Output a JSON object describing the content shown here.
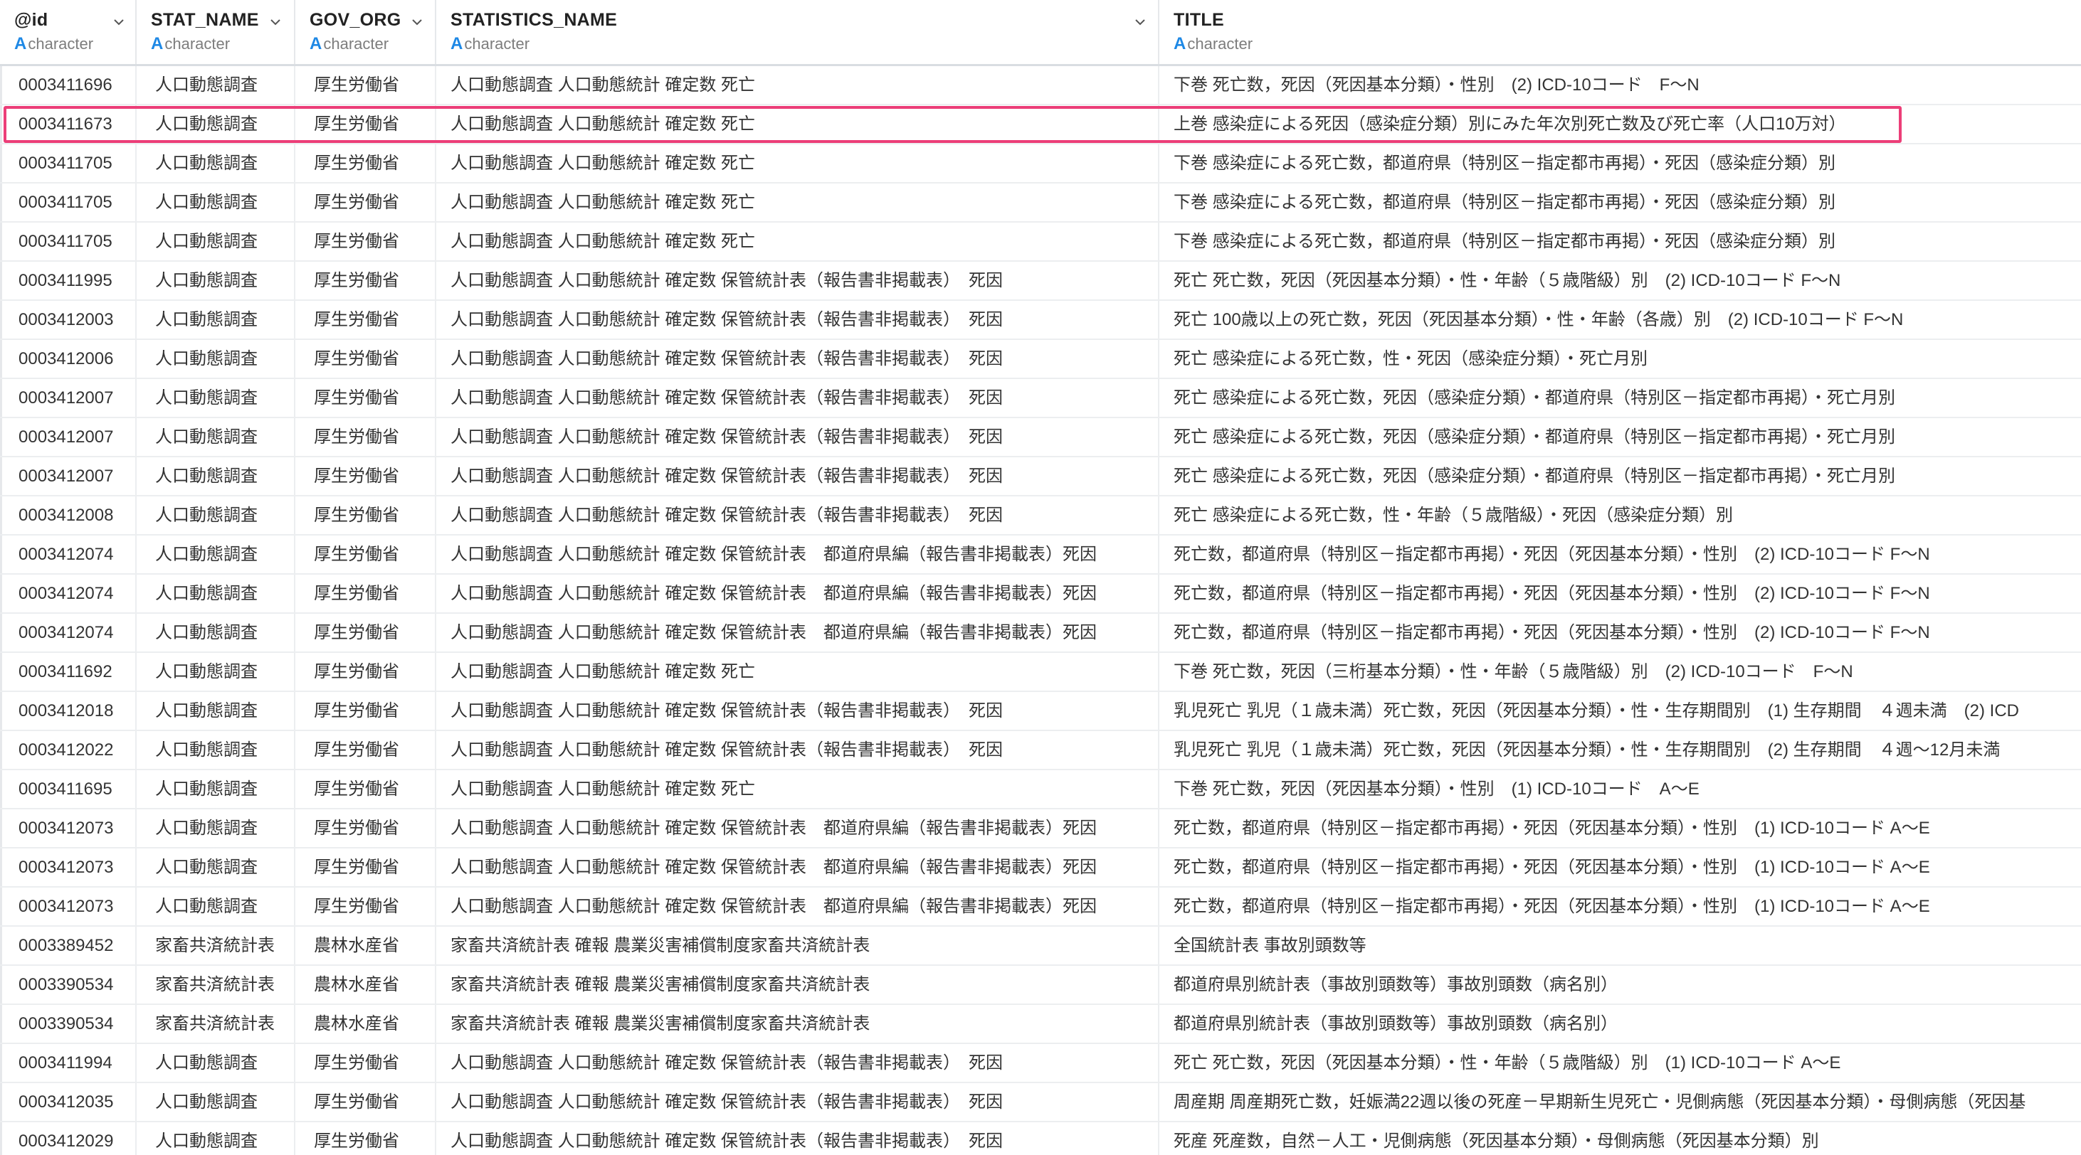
{
  "columns": [
    {
      "name": "@id",
      "type": "character",
      "type_icon": "A"
    },
    {
      "name": "STAT_NAME",
      "type": "character",
      "type_icon": "A"
    },
    {
      "name": "GOV_ORG",
      "type": "character",
      "type_icon": "A"
    },
    {
      "name": "STATISTICS_NAME",
      "type": "character",
      "type_icon": "A"
    },
    {
      "name": "TITLE",
      "type": "character",
      "type_icon": "A"
    }
  ],
  "colors": {
    "highlight_border": "#ec3e78",
    "type_icon": "#1e88e5",
    "grid_line": "#eceef0"
  },
  "highlighted_row_index": 1,
  "rows": [
    [
      "0003411696",
      "人口動態調査",
      "厚生労働省",
      "人口動態調査 人口動態統計 確定数 死亡",
      "下巻 死亡数，死因（死因基本分類）・性別　(2) ICD-10コード　F～N"
    ],
    [
      "0003411673",
      "人口動態調査",
      "厚生労働省",
      "人口動態調査 人口動態統計 確定数 死亡",
      "上巻 感染症による死因（感染症分類）別にみた年次別死亡数及び死亡率（人口10万対）"
    ],
    [
      "0003411705",
      "人口動態調査",
      "厚生労働省",
      "人口動態調査 人口動態統計 確定数 死亡",
      "下巻 感染症による死亡数，都道府県（特別区－指定都市再掲）・死因（感染症分類）別"
    ],
    [
      "0003411705",
      "人口動態調査",
      "厚生労働省",
      "人口動態調査 人口動態統計 確定数 死亡",
      "下巻 感染症による死亡数，都道府県（特別区－指定都市再掲）・死因（感染症分類）別"
    ],
    [
      "0003411705",
      "人口動態調査",
      "厚生労働省",
      "人口動態調査 人口動態統計 確定数 死亡",
      "下巻 感染症による死亡数，都道府県（特別区－指定都市再掲）・死因（感染症分類）別"
    ],
    [
      "0003411995",
      "人口動態調査",
      "厚生労働省",
      "人口動態調査 人口動態統計 確定数 保管統計表（報告書非掲載表）　死因",
      "死亡 死亡数，死因（死因基本分類）・性・年齢（５歳階級）別　(2) ICD-10コード F～N"
    ],
    [
      "0003412003",
      "人口動態調査",
      "厚生労働省",
      "人口動態調査 人口動態統計 確定数 保管統計表（報告書非掲載表）　死因",
      "死亡 100歳以上の死亡数，死因（死因基本分類）・性・年齢（各歳）別　(2) ICD-10コード F～N"
    ],
    [
      "0003412006",
      "人口動態調査",
      "厚生労働省",
      "人口動態調査 人口動態統計 確定数 保管統計表（報告書非掲載表）　死因",
      "死亡 感染症による死亡数，性・死因（感染症分類）・死亡月別"
    ],
    [
      "0003412007",
      "人口動態調査",
      "厚生労働省",
      "人口動態調査 人口動態統計 確定数 保管統計表（報告書非掲載表）　死因",
      "死亡 感染症による死亡数，死因（感染症分類）・都道府県（特別区－指定都市再掲）・死亡月別"
    ],
    [
      "0003412007",
      "人口動態調査",
      "厚生労働省",
      "人口動態調査 人口動態統計 確定数 保管統計表（報告書非掲載表）　死因",
      "死亡 感染症による死亡数，死因（感染症分類）・都道府県（特別区－指定都市再掲）・死亡月別"
    ],
    [
      "0003412007",
      "人口動態調査",
      "厚生労働省",
      "人口動態調査 人口動態統計 確定数 保管統計表（報告書非掲載表）　死因",
      "死亡 感染症による死亡数，死因（感染症分類）・都道府県（特別区－指定都市再掲）・死亡月別"
    ],
    [
      "0003412008",
      "人口動態調査",
      "厚生労働省",
      "人口動態調査 人口動態統計 確定数 保管統計表（報告書非掲載表）　死因",
      "死亡 感染症による死亡数，性・年齢（５歳階級）・死因（感染症分類）別"
    ],
    [
      "0003412074",
      "人口動態調査",
      "厚生労働省",
      "人口動態調査 人口動態統計 確定数 保管統計表　都道府県編（報告書非掲載表）死因",
      "死亡数，都道府県（特別区－指定都市再掲）・死因（死因基本分類）・性別　(2) ICD-10コード F～N"
    ],
    [
      "0003412074",
      "人口動態調査",
      "厚生労働省",
      "人口動態調査 人口動態統計 確定数 保管統計表　都道府県編（報告書非掲載表）死因",
      "死亡数，都道府県（特別区－指定都市再掲）・死因（死因基本分類）・性別　(2) ICD-10コード F～N"
    ],
    [
      "0003412074",
      "人口動態調査",
      "厚生労働省",
      "人口動態調査 人口動態統計 確定数 保管統計表　都道府県編（報告書非掲載表）死因",
      "死亡数，都道府県（特別区－指定都市再掲）・死因（死因基本分類）・性別　(2) ICD-10コード F～N"
    ],
    [
      "0003411692",
      "人口動態調査",
      "厚生労働省",
      "人口動態調査 人口動態統計 確定数 死亡",
      "下巻 死亡数，死因（三桁基本分類）・性・年齢（５歳階級）別　(2) ICD-10コード　F～N"
    ],
    [
      "0003412018",
      "人口動態調査",
      "厚生労働省",
      "人口動態調査 人口動態統計 確定数 保管統計表（報告書非掲載表）　死因",
      "乳児死亡 乳児（１歳未満）死亡数，死因（死因基本分類）・性・生存期間別　(1) 生存期間　４週未満　(2) ICD"
    ],
    [
      "0003412022",
      "人口動態調査",
      "厚生労働省",
      "人口動態調査 人口動態統計 確定数 保管統計表（報告書非掲載表）　死因",
      "乳児死亡 乳児（１歳未満）死亡数，死因（死因基本分類）・性・生存期間別　(2) 生存期間　４週～12月未満"
    ],
    [
      "0003411695",
      "人口動態調査",
      "厚生労働省",
      "人口動態調査 人口動態統計 確定数 死亡",
      "下巻 死亡数，死因（死因基本分類）・性別　(1) ICD-10コード　A～E"
    ],
    [
      "0003412073",
      "人口動態調査",
      "厚生労働省",
      "人口動態調査 人口動態統計 確定数 保管統計表　都道府県編（報告書非掲載表）死因",
      "死亡数，都道府県（特別区－指定都市再掲）・死因（死因基本分類）・性別　(1) ICD-10コード A～E"
    ],
    [
      "0003412073",
      "人口動態調査",
      "厚生労働省",
      "人口動態調査 人口動態統計 確定数 保管統計表　都道府県編（報告書非掲載表）死因",
      "死亡数，都道府県（特別区－指定都市再掲）・死因（死因基本分類）・性別　(1) ICD-10コード A～E"
    ],
    [
      "0003412073",
      "人口動態調査",
      "厚生労働省",
      "人口動態調査 人口動態統計 確定数 保管統計表　都道府県編（報告書非掲載表）死因",
      "死亡数，都道府県（特別区－指定都市再掲）・死因（死因基本分類）・性別　(1) ICD-10コード A～E"
    ],
    [
      "0003389452",
      "家畜共済統計表",
      "農林水産省",
      "家畜共済統計表 確報 農業災害補償制度家畜共済統計表",
      "全国統計表 事故別頭数等"
    ],
    [
      "0003390534",
      "家畜共済統計表",
      "農林水産省",
      "家畜共済統計表 確報 農業災害補償制度家畜共済統計表",
      "都道府県別統計表（事故別頭数等）事故別頭数（病名別）"
    ],
    [
      "0003390534",
      "家畜共済統計表",
      "農林水産省",
      "家畜共済統計表 確報 農業災害補償制度家畜共済統計表",
      "都道府県別統計表（事故別頭数等）事故別頭数（病名別）"
    ],
    [
      "0003411994",
      "人口動態調査",
      "厚生労働省",
      "人口動態調査 人口動態統計 確定数 保管統計表（報告書非掲載表）　死因",
      "死亡 死亡数，死因（死因基本分類）・性・年齢（５歳階級）別　(1) ICD-10コード A～E"
    ],
    [
      "0003412035",
      "人口動態調査",
      "厚生労働省",
      "人口動態調査 人口動態統計 確定数 保管統計表（報告書非掲載表）　死因",
      "周産期 周産期死亡数，妊娠満22週以後の死産－早期新生児死亡・児側病態（死因基本分類）・母側病態（死因基"
    ],
    [
      "0003412029",
      "人口動態調査",
      "厚生労働省",
      "人口動態調査 人口動態統計 確定数 保管統計表（報告書非掲載表）　死因",
      "死産 死産数，自然－人工・児側病態（死因基本分類）・母側病態（死因基本分類）別"
    ]
  ]
}
